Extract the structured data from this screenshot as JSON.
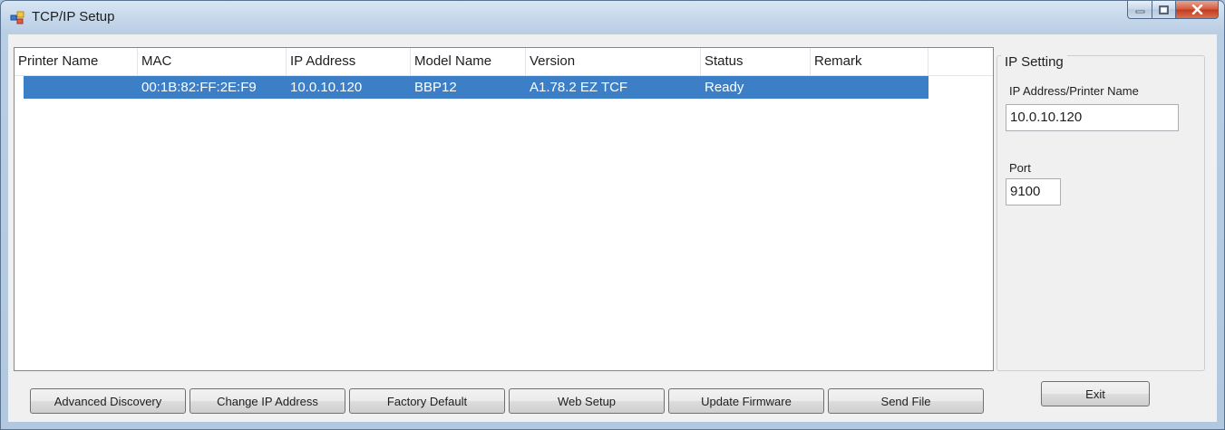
{
  "window": {
    "title": "TCP/IP Setup"
  },
  "list": {
    "columns": [
      "Printer Name",
      "MAC",
      "IP Address",
      "Model Name",
      "Version",
      "Status",
      "Remark"
    ],
    "rows": [
      {
        "printer_name": "",
        "mac": "00:1B:82:FF:2E:F9",
        "ip": "10.0.10.120",
        "model": "BBP12",
        "version": "A1.78.2 EZ TCF",
        "status": "Ready",
        "remark": ""
      }
    ]
  },
  "ip_setting": {
    "title": "IP Setting",
    "address_label": "IP Address/Printer Name",
    "address_value": "10.0.10.120",
    "port_label": "Port",
    "port_value": "9100"
  },
  "buttons": {
    "advanced_discovery": "Advanced Discovery",
    "change_ip": "Change IP Address",
    "factory_default": "Factory Default",
    "web_setup": "Web Setup",
    "update_firmware": "Update Firmware",
    "send_file": "Send File",
    "exit": "Exit"
  },
  "colors": {
    "selection": "#3d7fc6",
    "close_button": "#c4391e"
  }
}
